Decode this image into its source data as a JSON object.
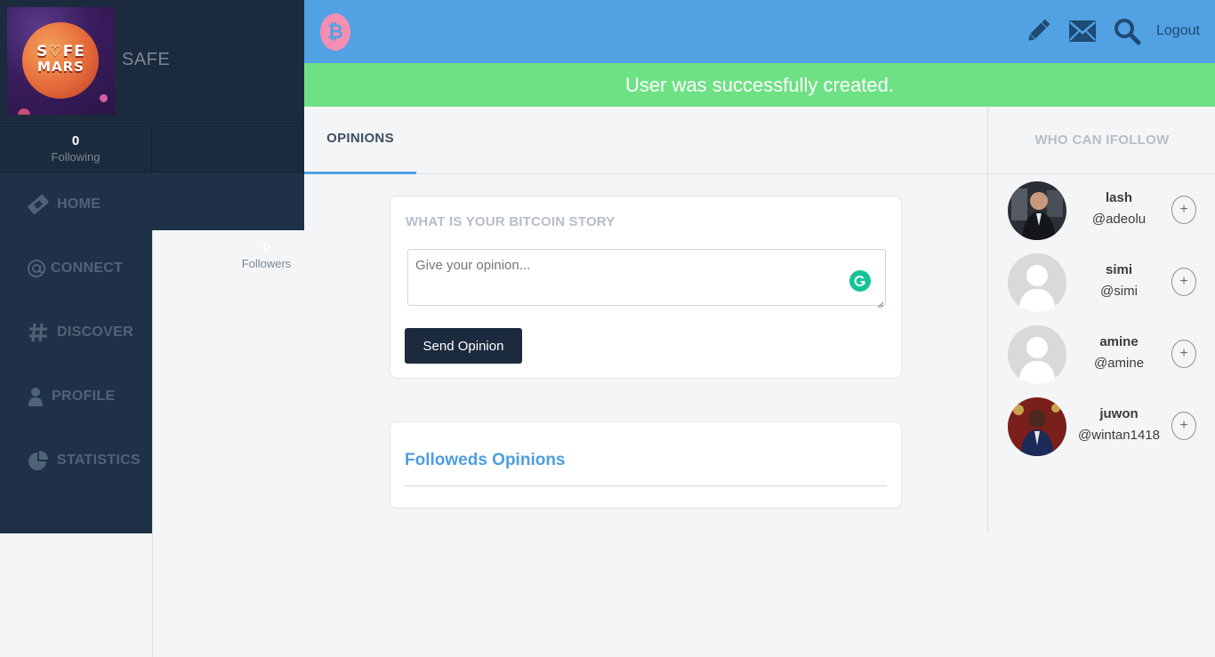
{
  "sidebar": {
    "avatar_logo": "SAFE MARS",
    "username": "SAFE",
    "stats": [
      {
        "value": "0",
        "label": "Following"
      },
      {
        "value": "0",
        "label": "Followers"
      }
    ],
    "nav": [
      {
        "label": "HOME",
        "icon": "ticket-icon"
      },
      {
        "label": "CONNECT",
        "icon": "at-icon"
      },
      {
        "label": "DISCOVER",
        "icon": "hashtag-icon"
      },
      {
        "label": "PROFILE",
        "icon": "user-icon"
      },
      {
        "label": "STATISTICS",
        "icon": "pie-chart-icon"
      }
    ]
  },
  "topbar": {
    "logo_glyph": "₿",
    "icons": [
      "pencil-icon",
      "envelope-icon",
      "search-icon"
    ],
    "logout_label": "Logout"
  },
  "banner": {
    "message": "User was successfully created."
  },
  "main": {
    "tab_label": "OPINIONS",
    "compose": {
      "title": "WHAT IS YOUR BITCOIN STORY",
      "placeholder": "Give your opinion...",
      "button_label": "Send Opinion"
    },
    "followed": {
      "title": "Followeds Opinions"
    }
  },
  "right_panel": {
    "title": "WHO CAN IFOLLOW",
    "users": [
      {
        "name": "lash",
        "handle": "@adeolu",
        "follow_label": "+"
      },
      {
        "name": "simi",
        "handle": "@simi",
        "follow_label": "+"
      },
      {
        "name": "amine",
        "handle": "@amine",
        "follow_label": "+"
      },
      {
        "name": "juwon",
        "handle": "@wintan1418",
        "follow_label": "+"
      }
    ]
  },
  "colors": {
    "sidebar_bg": "#1f3146",
    "topbar_bg": "#51a1e3",
    "banner_bg": "#6ee184",
    "button_bg": "#1c2a3d",
    "link_blue": "#4d9ee0"
  }
}
